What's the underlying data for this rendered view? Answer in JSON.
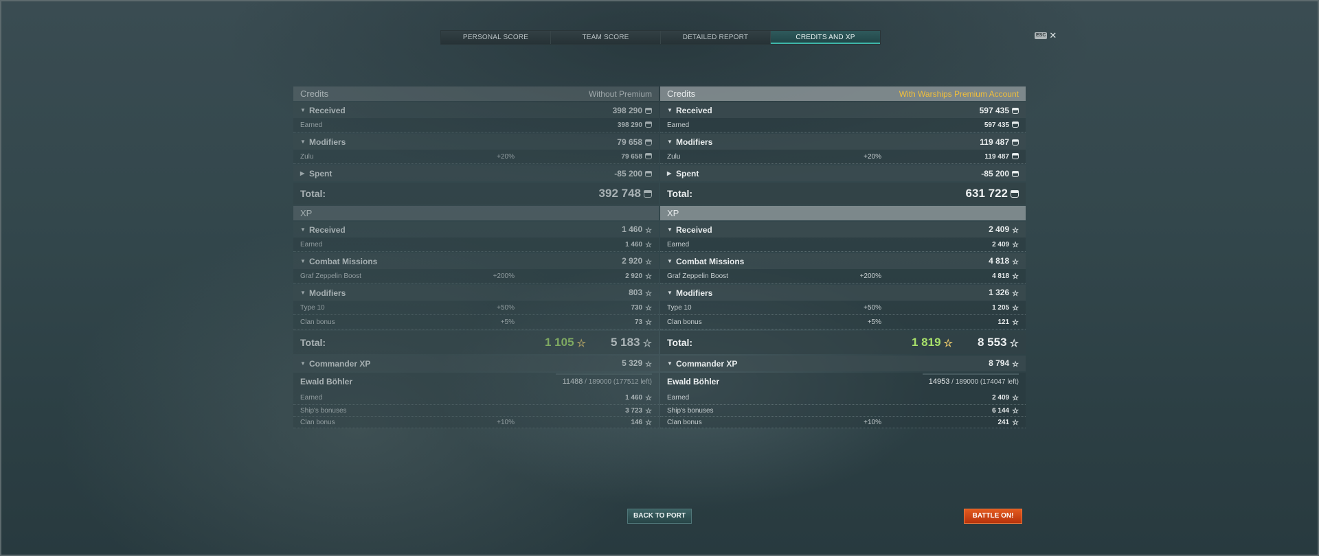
{
  "tabs": [
    {
      "label": "PERSONAL SCORE",
      "active": false
    },
    {
      "label": "TEAM SCORE",
      "active": false
    },
    {
      "label": "DETAILED REPORT",
      "active": false
    },
    {
      "label": "CREDITS AND XP",
      "active": true
    }
  ],
  "esc_key": "ESC",
  "close_glyph": "✕",
  "left": {
    "credits_title": "Credits",
    "credits_subtitle": "Without Premium",
    "received": {
      "label": "Received",
      "value": "398 290"
    },
    "earned": {
      "label": "Earned",
      "value": "398 290"
    },
    "modifiers": {
      "label": "Modifiers",
      "value": "79 658"
    },
    "zulu": {
      "label": "Zulu",
      "pct": "+20%",
      "value": "79 658"
    },
    "spent": {
      "label": "Spent",
      "value": "-85 200"
    },
    "credits_total": {
      "label": "Total:",
      "value": "392 748"
    },
    "xp_title": "XP",
    "xp_received": {
      "label": "Received",
      "value": "1 460"
    },
    "xp_earned": {
      "label": "Earned",
      "value": "1 460"
    },
    "combat_missions": {
      "label": "Combat Missions",
      "value": "2 920"
    },
    "graf": {
      "label": "Graf Zeppelin Boost",
      "pct": "+200%",
      "value": "2 920"
    },
    "xp_modifiers": {
      "label": "Modifiers",
      "value": "803"
    },
    "type10": {
      "label": "Type 10",
      "pct": "+50%",
      "value": "730"
    },
    "clan": {
      "label": "Clan bonus",
      "pct": "+5%",
      "value": "73"
    },
    "xp_total": {
      "label": "Total:",
      "free": "1 105",
      "value": "5 183"
    },
    "commander_xp": {
      "label": "Commander XP",
      "value": "5 329"
    },
    "commander": {
      "name": "Ewald Böhler",
      "current": "11488",
      "rest": "/ 189000 (177512 left)",
      "progress": 0.061
    },
    "c_earned": {
      "label": "Earned",
      "value": "1 460"
    },
    "c_ship": {
      "label": "Ship's bonuses",
      "value": "3 723"
    },
    "c_clan": {
      "label": "Clan bonus",
      "pct": "+10%",
      "value": "146"
    }
  },
  "right": {
    "credits_title": "Credits",
    "credits_subtitle": "With Warships Premium Account",
    "received": {
      "label": "Received",
      "value": "597 435"
    },
    "earned": {
      "label": "Earned",
      "value": "597 435"
    },
    "modifiers": {
      "label": "Modifiers",
      "value": "119 487"
    },
    "zulu": {
      "label": "Zulu",
      "pct": "+20%",
      "value": "119 487"
    },
    "spent": {
      "label": "Spent",
      "value": "-85 200"
    },
    "credits_total": {
      "label": "Total:",
      "value": "631 722"
    },
    "xp_title": "XP",
    "xp_received": {
      "label": "Received",
      "value": "2 409"
    },
    "xp_earned": {
      "label": "Earned",
      "value": "2 409"
    },
    "combat_missions": {
      "label": "Combat Missions",
      "value": "4 818"
    },
    "graf": {
      "label": "Graf Zeppelin Boost",
      "pct": "+200%",
      "value": "4 818"
    },
    "xp_modifiers": {
      "label": "Modifiers",
      "value": "1 326"
    },
    "type10": {
      "label": "Type 10",
      "pct": "+50%",
      "value": "1 205"
    },
    "clan": {
      "label": "Clan bonus",
      "pct": "+5%",
      "value": "121"
    },
    "xp_total": {
      "label": "Total:",
      "free": "1 819",
      "value": "8 553"
    },
    "commander_xp": {
      "label": "Commander XP",
      "value": "8 794"
    },
    "commander": {
      "name": "Ewald Böhler",
      "current": "14953",
      "rest": "/ 189000 (174047 left)",
      "progress": 0.079
    },
    "c_earned": {
      "label": "Earned",
      "value": "2 409"
    },
    "c_ship": {
      "label": "Ship's bonuses",
      "value": "6 144"
    },
    "c_clan": {
      "label": "Clan bonus",
      "pct": "+10%",
      "value": "241"
    }
  },
  "buttons": {
    "back": "BACK TO PORT",
    "battle": "BATTLE ON!"
  },
  "colors": {
    "accent": "#3fb6a9",
    "premium_gold": "#f1bf3a",
    "free_xp_green": "#a7e06a",
    "battle_orange": "#d8481a"
  }
}
